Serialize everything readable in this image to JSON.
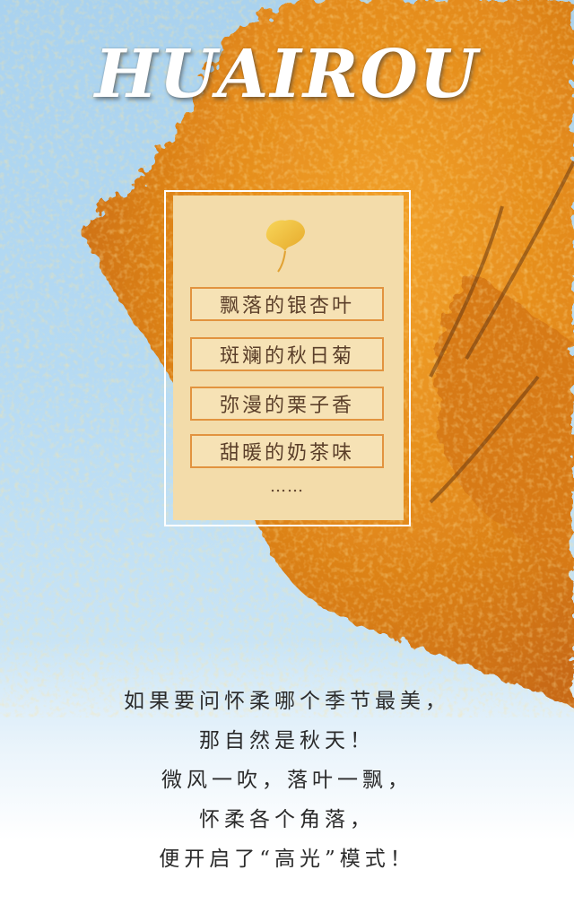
{
  "title": "HUAIROU",
  "icons": {
    "leaf": "ginkgo-leaf-icon",
    "tree": "autumn-ginkgo-tree"
  },
  "colors": {
    "sky": "#b5daf3",
    "foliage": "#e08a1e",
    "card": "#f3dcaa",
    "item_border": "#e2933f",
    "text": "#5b3f2a"
  },
  "card": {
    "items": [
      "飘落的银杏叶",
      "斑斓的秋日菊",
      "弥漫的栗子香",
      "甜暖的奶茶味"
    ],
    "ellipsis": "……"
  },
  "poem": [
    "如果要问怀柔哪个季节最美，",
    "那自然是秋天！",
    "微风一吹，落叶一飘，",
    "怀柔各个角落，",
    "便开启了“高光”模式！"
  ]
}
